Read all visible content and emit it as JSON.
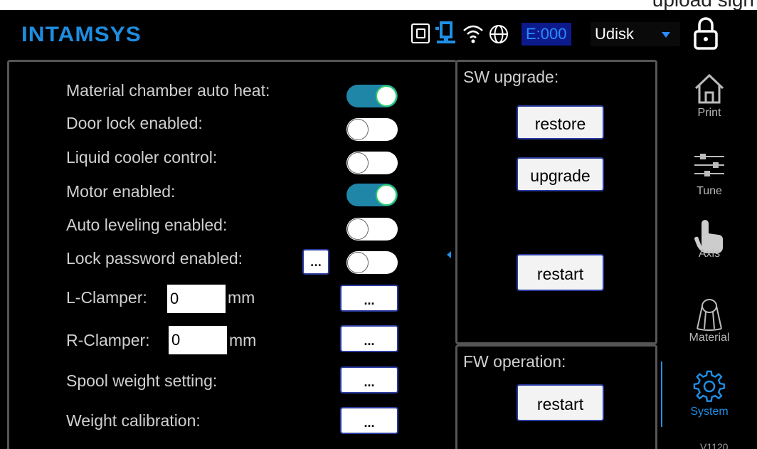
{
  "app": {
    "logo": "INTAMSYS",
    "top_strip_text": "upload sign",
    "version": "V1120"
  },
  "header": {
    "error_code": "E:000",
    "storage_select": "Udisk",
    "icons": [
      "sd-card-icon",
      "network-pc-icon",
      "wifi-icon",
      "globe-icon",
      "lock-icon"
    ]
  },
  "settings": {
    "material_chamber": "Material chamber auto heat:",
    "door_lock": "Door lock enabled:",
    "liquid_cooler": "Liquid cooler control:",
    "motor": "Motor enabled:",
    "auto_leveling": "Auto leveling enabled:",
    "lock_password": "Lock password enabled:",
    "lock_password_btn": "...",
    "l_clamper": "L-Clamper:",
    "l_clamper_value": "0",
    "r_clamper": "R-Clamper:",
    "r_clamper_value": "0",
    "unit": "mm",
    "spool_weight": "Spool weight setting:",
    "weight_calibration": "Weight calibration:",
    "dots": "...",
    "toggles": {
      "material_chamber": true,
      "door_lock": false,
      "liquid_cooler": false,
      "motor": true,
      "auto_leveling": false,
      "lock_password": false
    }
  },
  "sw_upgrade": {
    "title": "SW upgrade:",
    "restore": "restore",
    "upgrade": "upgrade",
    "restart": "restart"
  },
  "fw_operation": {
    "title": "FW operation:",
    "restart": "restart"
  },
  "sidebar": {
    "items": [
      {
        "label": "Print",
        "icon": "home-icon"
      },
      {
        "label": "Tune",
        "icon": "sliders-icon"
      },
      {
        "label": "Axis",
        "icon": "hand-pointer-icon"
      },
      {
        "label": "Material",
        "icon": "filament-spool-icon"
      },
      {
        "label": "System",
        "icon": "gear-icon",
        "active": true
      }
    ]
  },
  "colors": {
    "accent": "#1f8fe6",
    "toggle_on": "#1f86a8",
    "logo": "#1e8de0"
  }
}
